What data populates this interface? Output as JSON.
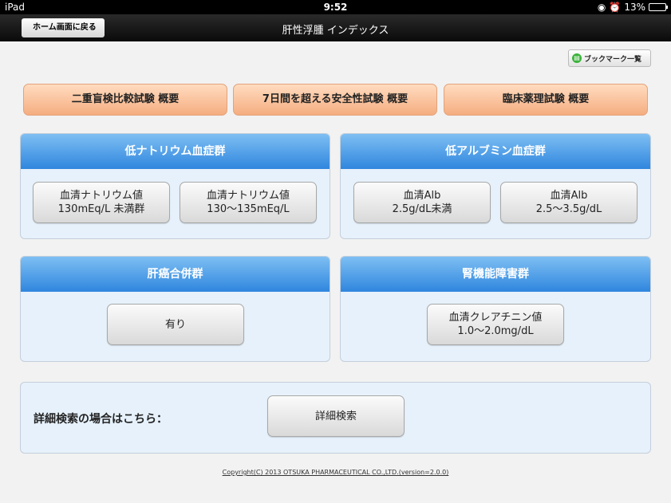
{
  "status_bar": {
    "device": "iPad",
    "time": "9:52",
    "battery": "13%",
    "battery_level": 0.13
  },
  "nav": {
    "back_label": "ホーム画面に戻る",
    "title": "肝性浮腫 インデックス"
  },
  "bookmark_label": "ブックマーク一覧",
  "top_buttons": [
    "二重盲検比較試験 概要",
    "7日間を超える安全性試験 概要",
    "臨床薬理試験 概要"
  ],
  "panels": {
    "hyponatremia": {
      "title": "低ナトリウム血症群",
      "buttons": [
        {
          "line1": "血清ナトリウム値",
          "line2": "130mEq/L 未満群"
        },
        {
          "line1": "血清ナトリウム値",
          "line2": "130〜135mEq/L"
        }
      ]
    },
    "hypoalbuminemia": {
      "title": "低アルブミン血症群",
      "buttons": [
        {
          "line1": "血清Alb",
          "line2": "2.5g/dL未満"
        },
        {
          "line1": "血清Alb",
          "line2": "2.5〜3.5g/dL"
        }
      ]
    },
    "liver_cancer": {
      "title": "肝癌合併群",
      "button": "有り"
    },
    "renal": {
      "title": "腎機能障害群",
      "button": {
        "line1": "血清クレアチニン値",
        "line2": "1.0〜2.0mg/dL"
      }
    }
  },
  "detail_search": {
    "label": "詳細検索の場合はこちら：",
    "button": "詳細検索"
  },
  "copyright": "Copyright(C) 2013 OTSUKA PHARMACEUTICAL CO.,LTD.(version=2.0.0)"
}
